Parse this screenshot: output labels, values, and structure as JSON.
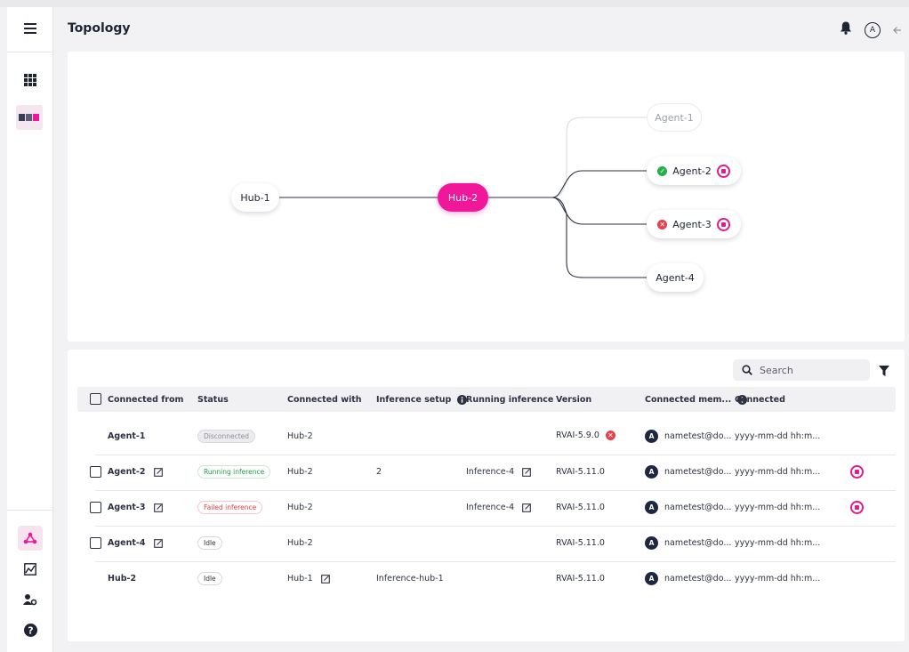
{
  "page": {
    "title": "Topology"
  },
  "header": {
    "avatar_letter": "A"
  },
  "topology": {
    "nodes": {
      "hub1": "Hub-1",
      "hub2": "Hub-2",
      "agent1": "Agent-1",
      "agent2": "Agent-2",
      "agent3": "Agent-3",
      "agent4": "Agent-4"
    }
  },
  "search": {
    "placeholder": "Search"
  },
  "table": {
    "headers": {
      "connected_from": "Connected from",
      "status": "Status",
      "connected_with": "Connected with",
      "inference_setup": "Inference setup",
      "running_inference": "Running inference",
      "version": "Version",
      "connected_members": "Connected mem...",
      "connected": "Connected"
    },
    "rows": [
      {
        "from": "Agent-1",
        "status": "Disconnected",
        "with": "Hub-2",
        "setup": "",
        "running": "",
        "version": "RVAI-5.9.0",
        "member_avatar": "A",
        "member": "nametest@do...",
        "connected": "yyyy-mm-dd hh:m..."
      },
      {
        "from": "Agent-2",
        "status": "Running inference",
        "with": "Hub-2",
        "setup": "2",
        "running": "Inference-4",
        "version": "RVAI-5.11.0",
        "member_avatar": "A",
        "member": "nametest@do...",
        "connected": "yyyy-mm-dd hh:m..."
      },
      {
        "from": "Agent-3",
        "status": "Failed inference",
        "with": "Hub-2",
        "setup": "",
        "running": "Inference-4",
        "version": "RVAI-5.11.0",
        "member_avatar": "A",
        "member": "nametest@do...",
        "connected": "yyyy-mm-dd hh:m..."
      },
      {
        "from": "Agent-4",
        "status": "Idle",
        "with": "Hub-2",
        "setup": "",
        "running": "",
        "version": "RVAI-5.11.0",
        "member_avatar": "A",
        "member": "nametest@do...",
        "connected": "yyyy-mm-dd hh:m..."
      },
      {
        "from": "Hub-2",
        "status": "Idle",
        "with": "Hub-1",
        "setup": "Inference-hub-1",
        "running": "",
        "version": "RVAI-5.11.0",
        "member_avatar": "A",
        "member": "nametest@do...",
        "connected": "yyyy-mm-dd hh:m..."
      }
    ]
  },
  "colors": {
    "accent": "#f0179a",
    "success": "#22b04b",
    "error": "#e5414c",
    "dark": "#1f2433"
  }
}
